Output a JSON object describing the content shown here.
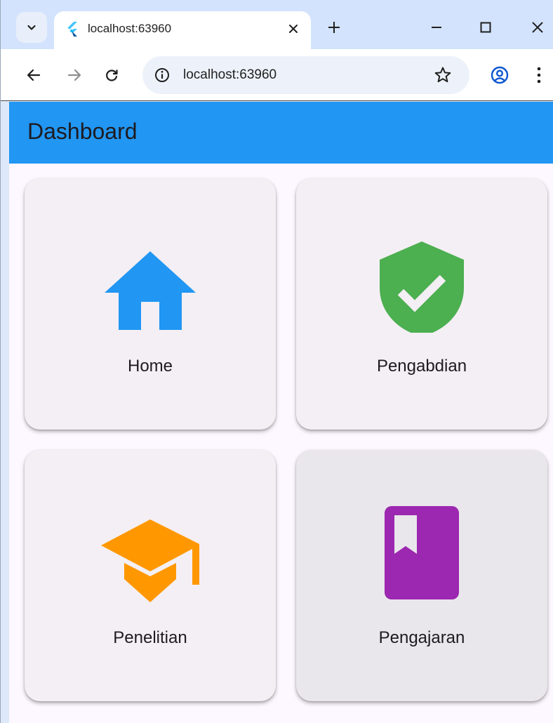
{
  "browser": {
    "tab_title": "localhost:63960",
    "address": "localhost:63960"
  },
  "app": {
    "title": "Dashboard",
    "colors": {
      "appbar": "#2196f3",
      "home_icon": "#2196f3",
      "pengabdian_icon": "#4caf50",
      "penelitian_icon": "#ff9800",
      "pengajaran_icon": "#9c27b0"
    },
    "cards": [
      {
        "label": "Home",
        "icon": "home-icon"
      },
      {
        "label": "Pengabdian",
        "icon": "verified-shield-icon"
      },
      {
        "label": "Penelitian",
        "icon": "graduation-cap-icon"
      },
      {
        "label": "Pengajaran",
        "icon": "book-icon"
      }
    ]
  }
}
